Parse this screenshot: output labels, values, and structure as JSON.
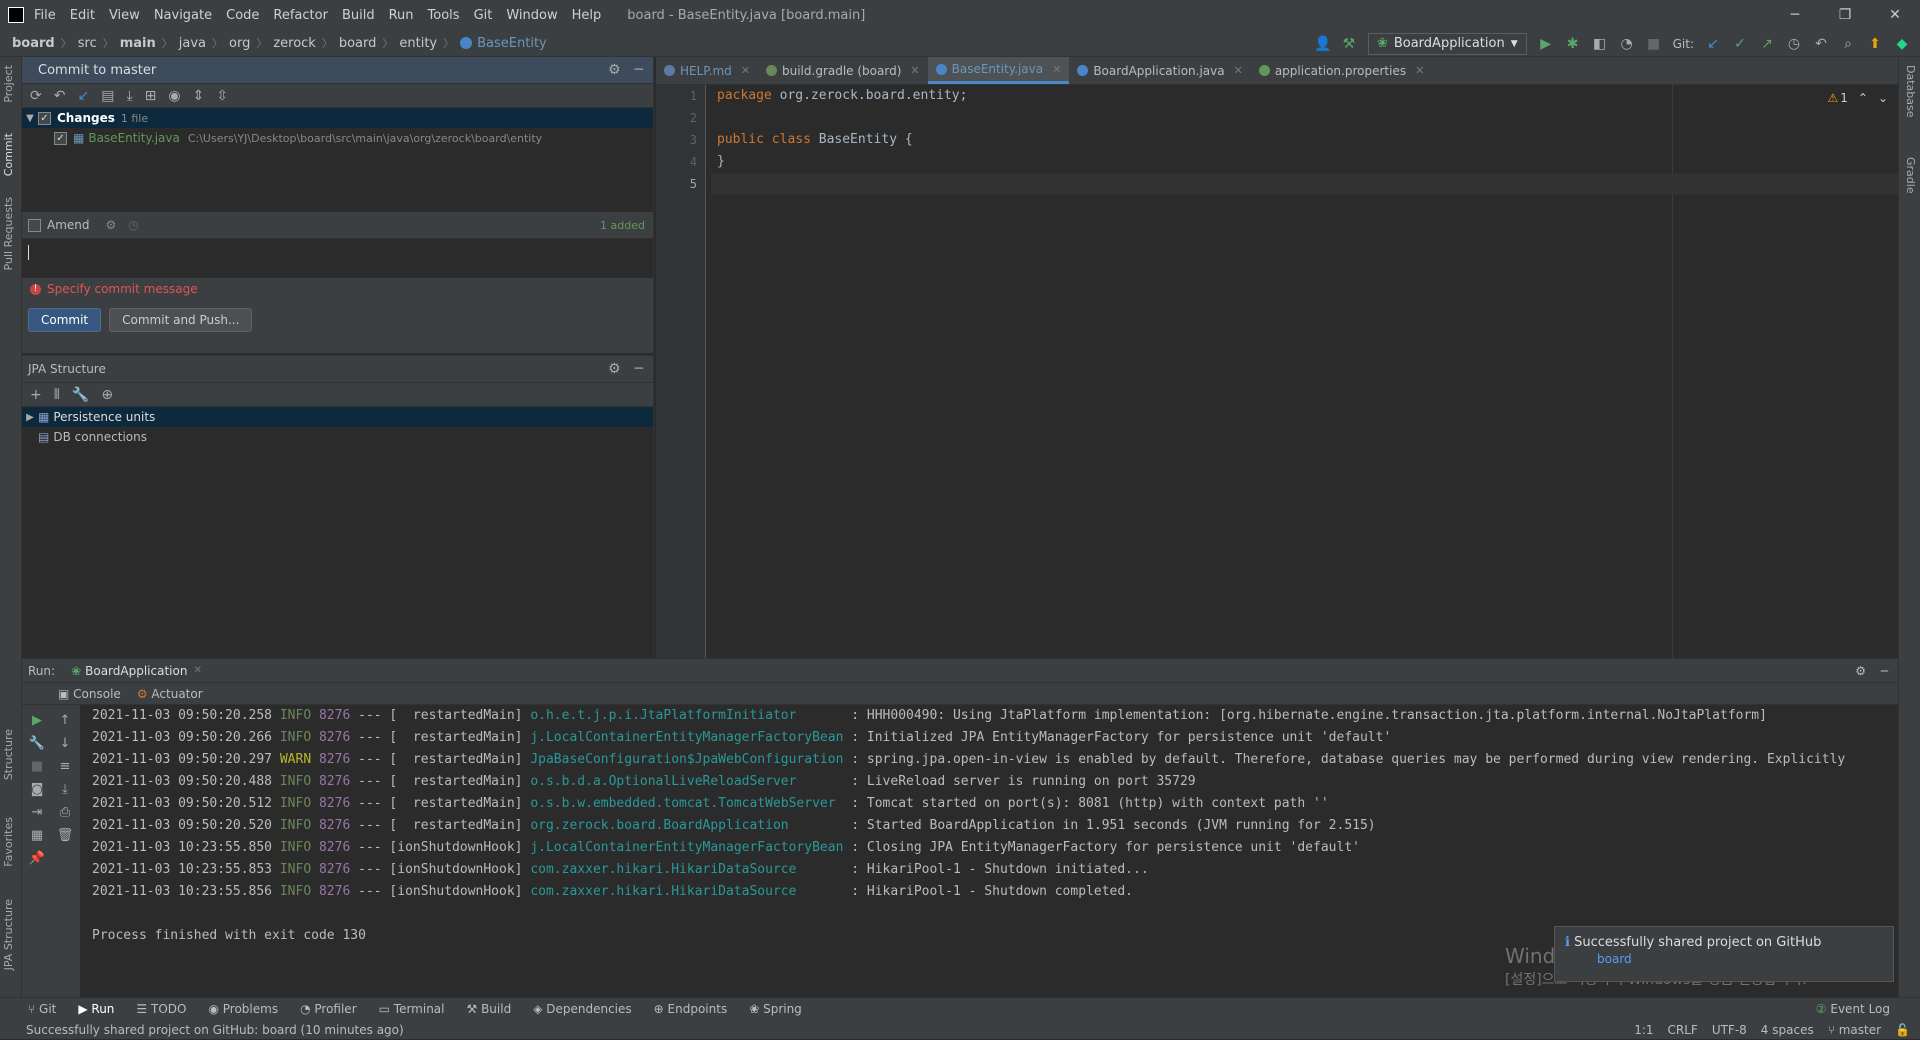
{
  "titlebar": {
    "menu": [
      "File",
      "Edit",
      "View",
      "Navigate",
      "Code",
      "Refactor",
      "Build",
      "Run",
      "Tools",
      "Git",
      "Window",
      "Help"
    ],
    "window_title": "board - BaseEntity.java [board.main]",
    "logo": "IJ"
  },
  "breadcrumb": [
    "board",
    "src",
    "main",
    "java",
    "org",
    "zerock",
    "board",
    "entity",
    "BaseEntity"
  ],
  "run_config": "BoardApplication",
  "git_label": "Git:",
  "left_tool_tabs": [
    "Project",
    "Commit",
    "Pull Requests",
    "Structure",
    "Favorites",
    "JPA Structure"
  ],
  "right_tool_tabs": [
    "Database",
    "Gradle"
  ],
  "commit_panel": {
    "title": "Commit to master",
    "changes_label": "Changes",
    "changes_count": "1 file",
    "file_name": "BaseEntity.java",
    "file_path": "C:\\Users\\YJ\\Desktop\\board\\src\\main\\java\\org\\zerock\\board\\entity",
    "amend_label": "Amend",
    "added_label": "1 added",
    "error_message": "Specify commit message",
    "commit_button": "Commit",
    "commit_push_button": "Commit and Push..."
  },
  "jpa_panel": {
    "title": "JPA Structure",
    "items": [
      "Persistence units",
      "DB connections"
    ]
  },
  "editor": {
    "tabs": [
      {
        "label": "HELP.md",
        "active": false
      },
      {
        "label": "build.gradle (board)",
        "active": false
      },
      {
        "label": "BaseEntity.java",
        "active": true
      },
      {
        "label": "BoardApplication.java",
        "active": false
      },
      {
        "label": "application.properties",
        "active": false
      }
    ],
    "line_numbers": [
      "1",
      "2",
      "3",
      "4",
      "5"
    ],
    "code": {
      "l1_kw": "package",
      "l1_rest": " org.zerock.board.entity;",
      "l3_kw": "public class",
      "l3_rest": " BaseEntity {",
      "l4": "}"
    },
    "warning_count": "1"
  },
  "run_panel": {
    "label": "Run:",
    "config_tab": "BoardApplication",
    "subtabs": [
      "Console",
      "Actuator"
    ],
    "logs": [
      {
        "ts": "2021-11-03 09:50:20.258",
        "lvl": "INFO",
        "pid": "8276",
        "thread": "--- [  restartedMain]",
        "logger": "o.h.e.t.j.p.i.JtaPlatformInitiator      ",
        "msg": ": HHH000490: Using JtaPlatform implementation: [org.hibernate.engine.transaction.jta.platform.internal.NoJtaPlatform]"
      },
      {
        "ts": "2021-11-03 09:50:20.266",
        "lvl": "INFO",
        "pid": "8276",
        "thread": "--- [  restartedMain]",
        "logger": "j.LocalContainerEntityManagerFactoryBean",
        "msg": ": Initialized JPA EntityManagerFactory for persistence unit 'default'"
      },
      {
        "ts": "2021-11-03 09:50:20.297",
        "lvl": "WARN",
        "pid": "8276",
        "thread": "--- [  restartedMain]",
        "logger": "JpaBaseConfiguration$JpaWebConfiguration",
        "msg": ": spring.jpa.open-in-view is enabled by default. Therefore, database queries may be performed during view rendering. Explicitly"
      },
      {
        "ts": "2021-11-03 09:50:20.488",
        "lvl": "INFO",
        "pid": "8276",
        "thread": "--- [  restartedMain]",
        "logger": "o.s.b.d.a.OptionalLiveReloadServer      ",
        "msg": ": LiveReload server is running on port 35729"
      },
      {
        "ts": "2021-11-03 09:50:20.512",
        "lvl": "INFO",
        "pid": "8276",
        "thread": "--- [  restartedMain]",
        "logger": "o.s.b.w.embedded.tomcat.TomcatWebServer ",
        "msg": ": Tomcat started on port(s): 8081 (http) with context path ''"
      },
      {
        "ts": "2021-11-03 09:50:20.520",
        "lvl": "INFO",
        "pid": "8276",
        "thread": "--- [  restartedMain]",
        "logger": "org.zerock.board.BoardApplication       ",
        "msg": ": Started BoardApplication in 1.951 seconds (JVM running for 2.515)"
      },
      {
        "ts": "2021-11-03 10:23:55.850",
        "lvl": "INFO",
        "pid": "8276",
        "thread": "--- [ionShutdownHook]",
        "logger": "j.LocalContainerEntityManagerFactoryBean",
        "msg": ": Closing JPA EntityManagerFactory for persistence unit 'default'"
      },
      {
        "ts": "2021-11-03 10:23:55.853",
        "lvl": "INFO",
        "pid": "8276",
        "thread": "--- [ionShutdownHook]",
        "logger": "com.zaxxer.hikari.HikariDataSource      ",
        "msg": ": HikariPool-1 - Shutdown initiated..."
      },
      {
        "ts": "2021-11-03 10:23:55.856",
        "lvl": "INFO",
        "pid": "8276",
        "thread": "--- [ionShutdownHook]",
        "logger": "com.zaxxer.hikari.HikariDataSource      ",
        "msg": ": HikariPool-1 - Shutdown completed."
      }
    ],
    "exit_message": "Process finished with exit code 130"
  },
  "bottom_tabs": [
    "Git",
    "Run",
    "TODO",
    "Problems",
    "Profiler",
    "Terminal",
    "Build",
    "Dependencies",
    "Endpoints",
    "Spring"
  ],
  "event_log": "Event Log",
  "status": {
    "message": "Successfully shared project on GitHub: board (10 minutes ago)",
    "position": "1:1",
    "line_sep": "CRLF",
    "encoding": "UTF-8",
    "indent": "4 spaces",
    "branch": "master"
  },
  "notification": {
    "title": "Successfully shared project on GitHub",
    "link": "board"
  },
  "watermark": {
    "line1": "Windows 정품 인증",
    "line2": "[설정]으로 이동하여 Windows를 정품 인증합니다."
  },
  "colors": {
    "accent": "#4a88c7",
    "keyword": "#cc7832",
    "info": "#6a8759",
    "warn": "#bbb529",
    "logger": "#299999",
    "error": "#e05555"
  }
}
